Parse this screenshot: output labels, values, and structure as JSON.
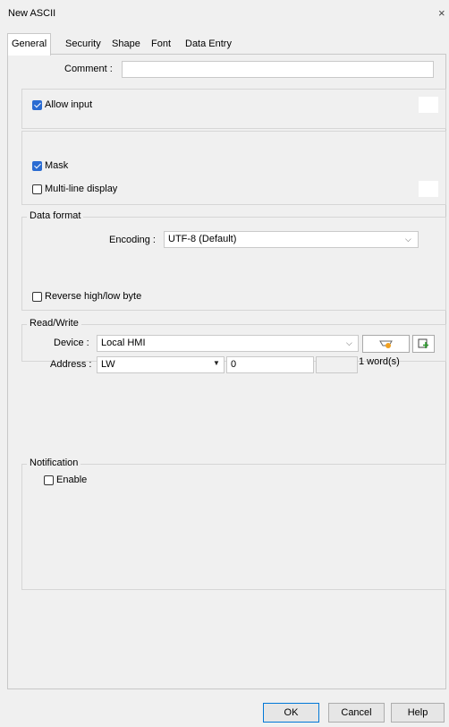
{
  "window": {
    "title": "New ASCII",
    "close_glyph": "×"
  },
  "tabs": [
    "General",
    "Security",
    "Shape",
    "Font",
    "Data Entry"
  ],
  "general": {
    "comment_label": "Comment :",
    "comment_value": "",
    "allow_input": {
      "label": "Allow input",
      "checked": true
    },
    "mask": {
      "label": "Mask",
      "checked": true
    },
    "multiline": {
      "label": "Multi-line display",
      "checked": false
    }
  },
  "data_format": {
    "legend": "Data format",
    "encoding_label": "Encoding :",
    "encoding_value": "UTF-8 (Default)",
    "reverse": {
      "label": "Reverse high/low byte",
      "checked": false
    }
  },
  "read_write": {
    "legend": "Read/Write",
    "device_label": "Device :",
    "device_value": "Local HMI",
    "address_label": "Address :",
    "address_type": "LW",
    "address_value": "0",
    "word_count": "1 word(s)"
  },
  "notification": {
    "legend": "Notification",
    "enable": {
      "label": "Enable",
      "checked": false
    }
  },
  "buttons": {
    "ok": "OK",
    "cancel": "Cancel",
    "help": "Help"
  },
  "icons": {
    "chevron": "chevron-down-icon",
    "settings": "device-settings-icon",
    "add": "add-address-icon"
  },
  "colors": {
    "accent": "#2b6cd2",
    "background": "#f0f0f0"
  }
}
